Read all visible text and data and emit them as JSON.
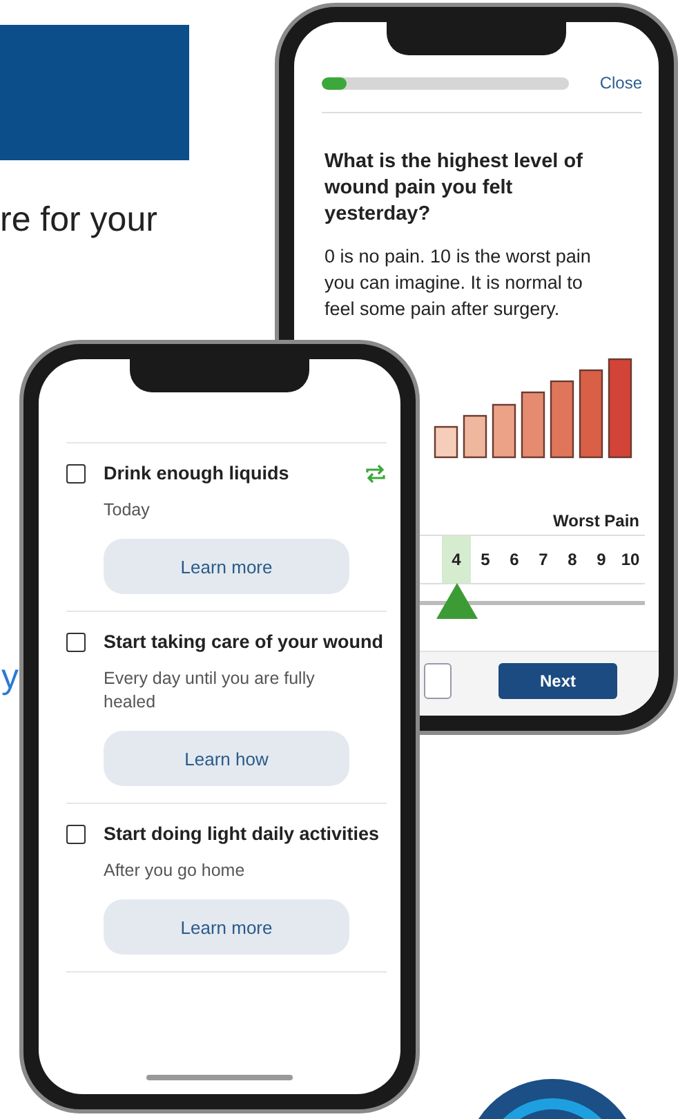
{
  "page": {
    "heading_fragment": "re for your",
    "link_fragment": "y"
  },
  "quiz_phone": {
    "progress": {
      "level": 0.1
    },
    "close": "Close",
    "question": "What is the highest level of wound pain you felt yesterday?",
    "description": "0 is no pain. 10 is the worst pain you can imagine. It is normal to feel some pain after surgery.",
    "scale_label": "Worst Pain",
    "scale": [
      {
        "label": "4",
        "selected": true
      },
      {
        "label": "5",
        "selected": false
      },
      {
        "label": "6",
        "selected": false
      },
      {
        "label": "7",
        "selected": false
      },
      {
        "label": "8",
        "selected": false
      },
      {
        "label": "9",
        "selected": false
      },
      {
        "label": "10",
        "selected": false
      }
    ],
    "next": "Next"
  },
  "tasks_phone": {
    "tasks": [
      {
        "title": "Drink enough liquids",
        "subtitle": "Today",
        "button": "Learn more",
        "checked": false,
        "recurring": true
      },
      {
        "title": "Start taking care of your wound",
        "subtitle": "Every day until you are fully healed",
        "button": "Learn how",
        "checked": false,
        "recurring": false
      },
      {
        "title": "Start doing light daily activities",
        "subtitle": "After you go home",
        "button": "Learn more",
        "checked": false,
        "recurring": false
      }
    ]
  }
}
